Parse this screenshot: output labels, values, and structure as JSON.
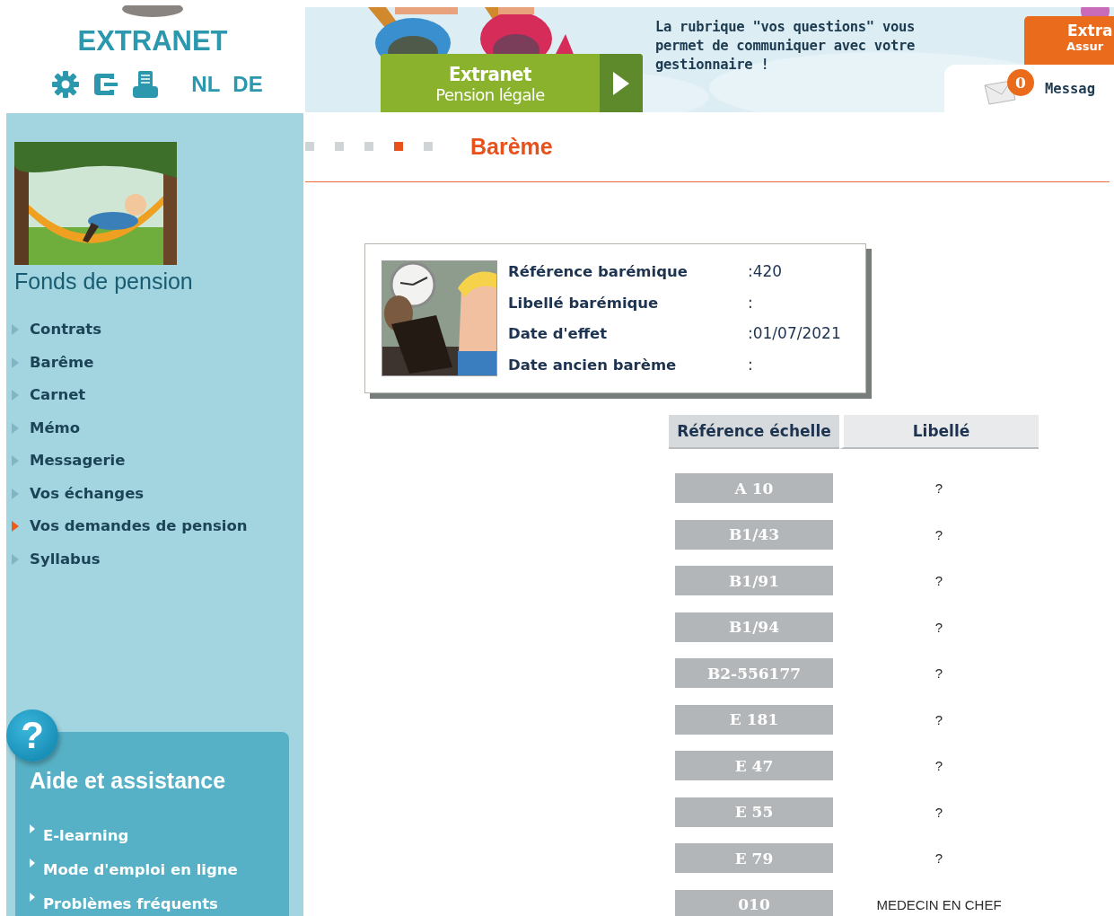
{
  "logo": {
    "title": "EXTRANET"
  },
  "toolbar": {
    "languages": [
      "NL",
      "DE"
    ]
  },
  "banner": {
    "product_button": {
      "title": "Extranet",
      "subtitle": "Pension légale"
    },
    "notice": "La rubrique \"vos questions\" vous permet de communiquer avec votre gestionnaire !",
    "side_button": {
      "title": "Extra",
      "subtitle": "Assur"
    },
    "messages": {
      "count": "0",
      "label": "Messag"
    }
  },
  "sidebar": {
    "title": "Fonds de pension",
    "items": [
      {
        "label": "Contrats",
        "selected": false
      },
      {
        "label": "Barême",
        "selected": false
      },
      {
        "label": "Carnet",
        "selected": false
      },
      {
        "label": "Mémo",
        "selected": false
      },
      {
        "label": "Messagerie",
        "selected": false
      },
      {
        "label": "Vos échanges",
        "selected": false
      },
      {
        "label": "Vos demandes de pension",
        "selected": true
      },
      {
        "label": "Syllabus",
        "selected": false
      }
    ]
  },
  "help": {
    "icon": "?",
    "title": "Aide et assistance",
    "links": [
      "E-learning",
      "Mode d'emploi en ligne",
      "Problèmes fréquents"
    ]
  },
  "page": {
    "steps": [
      {
        "selected": false
      },
      {
        "selected": false
      },
      {
        "selected": false
      },
      {
        "selected": true
      },
      {
        "selected": false
      }
    ],
    "title": "Barème"
  },
  "info_card": {
    "fields": [
      {
        "label": "Référence barémique",
        "value": ":420"
      },
      {
        "label": "Libellé barémique",
        "value": ":"
      },
      {
        "label": "Date d'effet",
        "value": ":01/07/2021"
      },
      {
        "label": "Date ancien barème",
        "value": ":"
      }
    ]
  },
  "table": {
    "columns": [
      "Référence échelle",
      "Libellé"
    ],
    "rows": [
      [
        "A 10",
        "?"
      ],
      [
        "B1/43",
        "?"
      ],
      [
        "B1/91",
        "?"
      ],
      [
        "B1/94",
        "?"
      ],
      [
        "B2-556177",
        "?"
      ],
      [
        "E 181",
        "?"
      ],
      [
        "E 47",
        "?"
      ],
      [
        "E 55",
        "?"
      ],
      [
        "E 79",
        "?"
      ],
      [
        "010",
        "MEDECIN EN CHEF"
      ]
    ]
  }
}
